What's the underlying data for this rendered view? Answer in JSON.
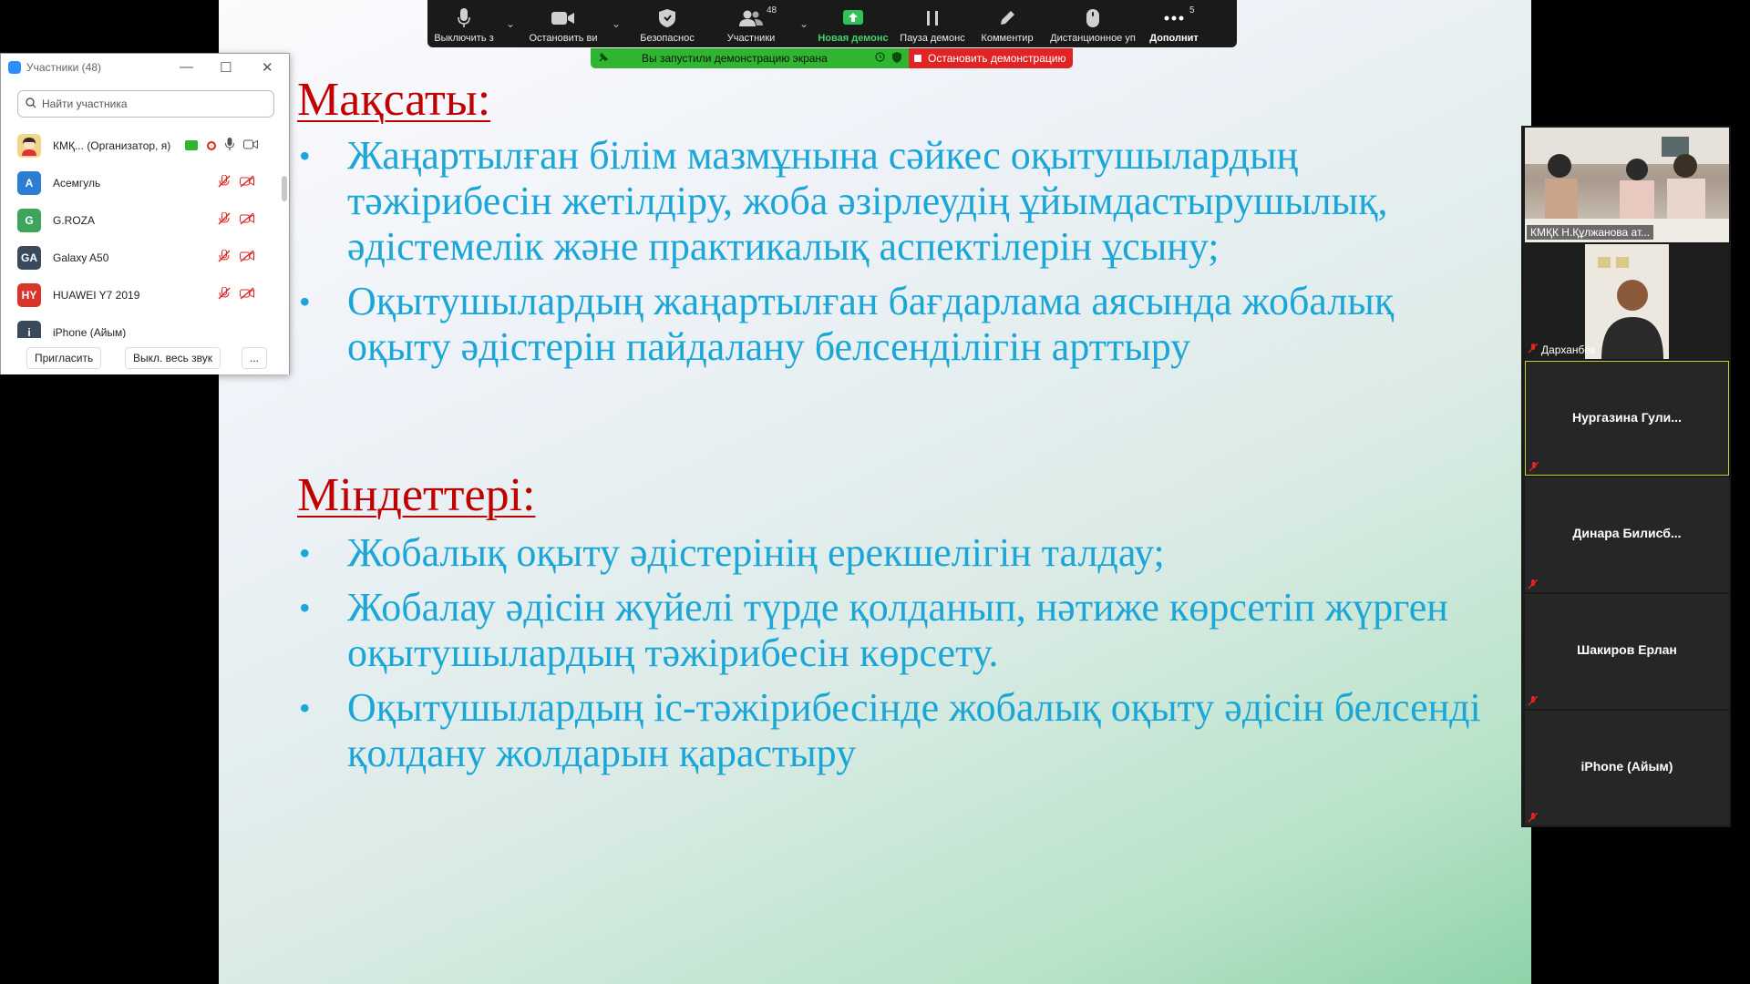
{
  "toolbar": {
    "mute_label": "Выключить з",
    "video_label": "Остановить ви",
    "security_label": "Безопаснос",
    "participants_label": "Участники",
    "participants_count": "48",
    "new_share_label": "Новая демонс",
    "pause_share_label": "Пауза демонс",
    "annotate_label": "Комментир",
    "remote_label": "Дистанционное уп",
    "more_label": "Дополнит",
    "more_count": "5"
  },
  "share_bar": {
    "status": "Вы запустили демонстрацию экрана",
    "stop_label": "Остановить демонстрацию"
  },
  "participants_panel": {
    "title": "Участники (48)",
    "search_placeholder": "Найти участника",
    "rows": [
      {
        "initials": "",
        "name": "КМҚ... (Организатор, я)",
        "color": "#f0c040"
      },
      {
        "initials": "A",
        "name": "Асемгуль",
        "color": "#2d7dd2"
      },
      {
        "initials": "G",
        "name": "G.ROZA",
        "color": "#3ba55c"
      },
      {
        "initials": "GA",
        "name": "Galaxy A50",
        "color": "#3a4a5c"
      },
      {
        "initials": "HY",
        "name": "HUAWEI Y7 2019",
        "color": "#d9362b"
      },
      {
        "initials": "i",
        "name": "iPhone (Айым)",
        "color": "#3a4a5c"
      }
    ],
    "invite_label": "Пригласить",
    "mute_all_label": "Выкл. весь звук",
    "more_label": "..."
  },
  "slide": {
    "heading1": "Мақсаты:",
    "goals": [
      "Жаңартылған білім  мазмұнына сәйкес оқытушылардың тәжірибесін жетілдіру, жоба әзірлеудің ұйымдастырушылық, әдістемелік және практикалық аспектілерін ұсыну;",
      "Оқытушылардың жаңартылған бағдарлама аясында жобалық оқыту әдістерін пайдалану белсенділігін арттыру"
    ],
    "heading2": "Міндеттері:",
    "tasks": [
      "Жобалық оқыту әдістерінің ерекшелігін талдау;",
      "Жобалау әдісін жүйелі түрде қолданып, нәтиже көрсетіп жүрген оқытушылардың  тәжірибесін көрсету.",
      "Оқытушылардың іс-тәжірибесінде жобалық оқыту әдісін белсенді қолдану жолдарын қарастыру"
    ],
    "bullet": "•"
  },
  "videos": [
    {
      "label": "КМҚК Н.Құлжанова ат...",
      "center": ""
    },
    {
      "label": "Дарханбек",
      "center": ""
    },
    {
      "label": "",
      "center": "Нургазина  Гули..."
    },
    {
      "label": "",
      "center": "Динара  Билисб..."
    },
    {
      "label": "",
      "center": "Шакиров Ерлан"
    },
    {
      "label": "",
      "center": "iPhone (Айым)"
    }
  ]
}
